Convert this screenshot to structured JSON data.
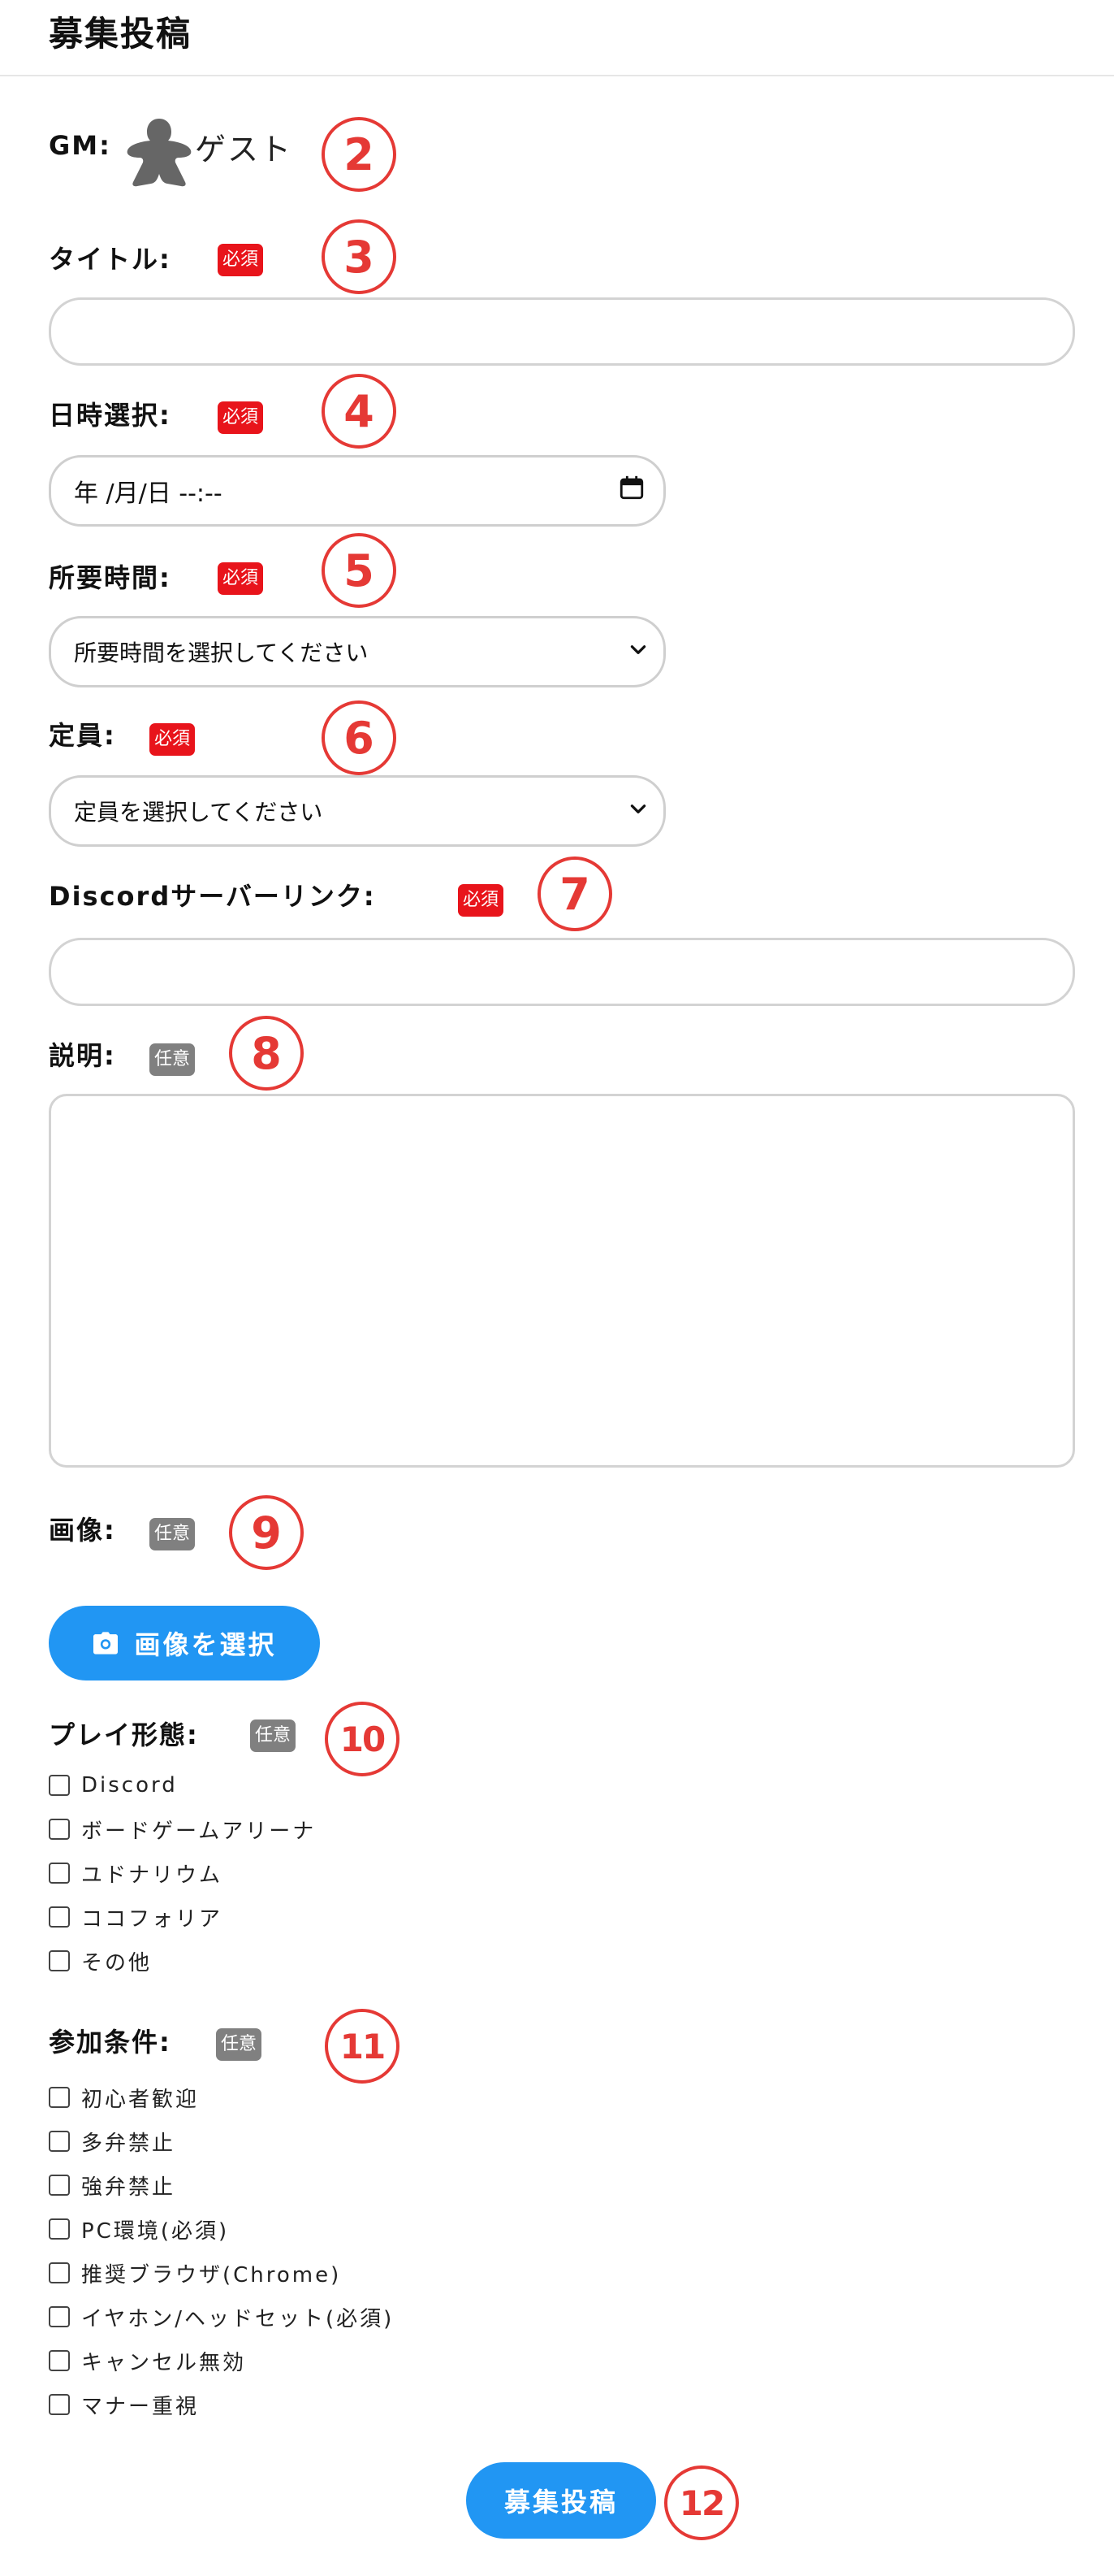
{
  "header": {
    "title": "募集投稿"
  },
  "gm": {
    "label": "GM:",
    "name": "ゲスト"
  },
  "callouts": [
    "2",
    "3",
    "4",
    "5",
    "6",
    "7",
    "8",
    "9",
    "10",
    "11",
    "12"
  ],
  "badges": {
    "required": "必須",
    "optional": "任意"
  },
  "fields": {
    "title": {
      "label": "タイトル:",
      "value": ""
    },
    "datetime": {
      "label": "日時選択:",
      "value": "年 /月/日 --:--"
    },
    "duration": {
      "label": "所要時間:",
      "selected": "所要時間を選択してください"
    },
    "capacity": {
      "label": "定員:",
      "selected": "定員を選択してください"
    },
    "discord": {
      "label": "Discordサーバーリンク:",
      "value": ""
    },
    "description": {
      "label": "説明:",
      "value": ""
    },
    "image": {
      "label": "画像:",
      "button": "画像を選択"
    }
  },
  "play_style": {
    "label": "プレイ形態:",
    "options": [
      {
        "label": "Discord",
        "checked": false
      },
      {
        "label": "ボードゲームアリーナ",
        "checked": false
      },
      {
        "label": "ユドナリウム",
        "checked": false
      },
      {
        "label": "ココフォリア",
        "checked": false
      },
      {
        "label": "その他",
        "checked": false
      }
    ]
  },
  "conditions": {
    "label": "参加条件:",
    "options": [
      {
        "label": "初心者歓迎",
        "checked": false
      },
      {
        "label": "多弁禁止",
        "checked": false
      },
      {
        "label": "強弁禁止",
        "checked": false
      },
      {
        "label": "PC環境(必須)",
        "checked": false
      },
      {
        "label": "推奨ブラウザ(Chrome)",
        "checked": false
      },
      {
        "label": "イヤホン/ヘッドセット(必須)",
        "checked": false
      },
      {
        "label": "キャンセル無効",
        "checked": false
      },
      {
        "label": "マナー重視",
        "checked": false
      }
    ]
  },
  "submit": {
    "label": "募集投稿"
  },
  "colors": {
    "accent": "#2196f3",
    "required": "#e8141b",
    "optional": "#808080",
    "callout": "#e53935"
  }
}
